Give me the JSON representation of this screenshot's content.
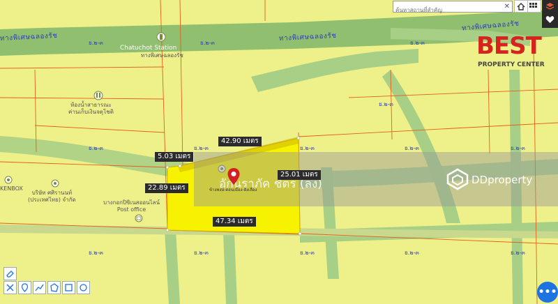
{
  "search": {
    "placeholder": "ค้นหาสถานที่สำคัญ",
    "close_label": "✕"
  },
  "toolbar_top": {
    "home_icon": "home-icon",
    "grid_icon": "grid-icon"
  },
  "side_panel": {
    "layers_icon": "layers-icon",
    "favorite_icon": "heart-icon"
  },
  "roads": {
    "expressway_left": "ทางพิเศษฉลองรัช",
    "expressway_right": "ทางพิเศษฉลองรัช"
  },
  "zone_code": "ย.๒-๓",
  "places": {
    "chatuchot_title": "Chatuchot Station",
    "chatuchot_sub": "ทางพิเศษฉลองรัช",
    "cemetery": "ห้องน้ำสาธารณะ\nค่านเก็บเงินจตุโชติ",
    "kenbox": "KENBOX",
    "company": "บริษัท ศศิรานนท์\n(ประเทศไทย) จำกัด",
    "post_office": "บางกอกปิซิเนสออนไลน์\nPost office",
    "pin_label": "ข้างพงษ์-ดอนเมือง-ฝั่งเลือง"
  },
  "measurements": {
    "top": "42.90 เมตร",
    "left_top": "5.03 เมตร",
    "right": "25.01 เมตร",
    "left": "22.89 เมตร",
    "bottom": "47.34 เมตร"
  },
  "overlay": {
    "owner_watermark": "อักนราภัค ชัตร  (ลง)",
    "ddproperty": "DDproperty"
  },
  "brand": {
    "title": "BEST",
    "subtitle": "PROPERTY CENTER"
  },
  "tools": [
    "eraser-icon",
    "measure-icon",
    "pin-icon",
    "line-icon",
    "polygon-icon",
    "rectangle-icon",
    "circle-icon"
  ],
  "fab_label": "•••",
  "colors": {
    "plot": "#f7f200",
    "background": "#eef089",
    "road": "#9fcb82",
    "expressway": "#8fbf6f",
    "boundary": "#e2601b",
    "brand": "#d6231e"
  }
}
